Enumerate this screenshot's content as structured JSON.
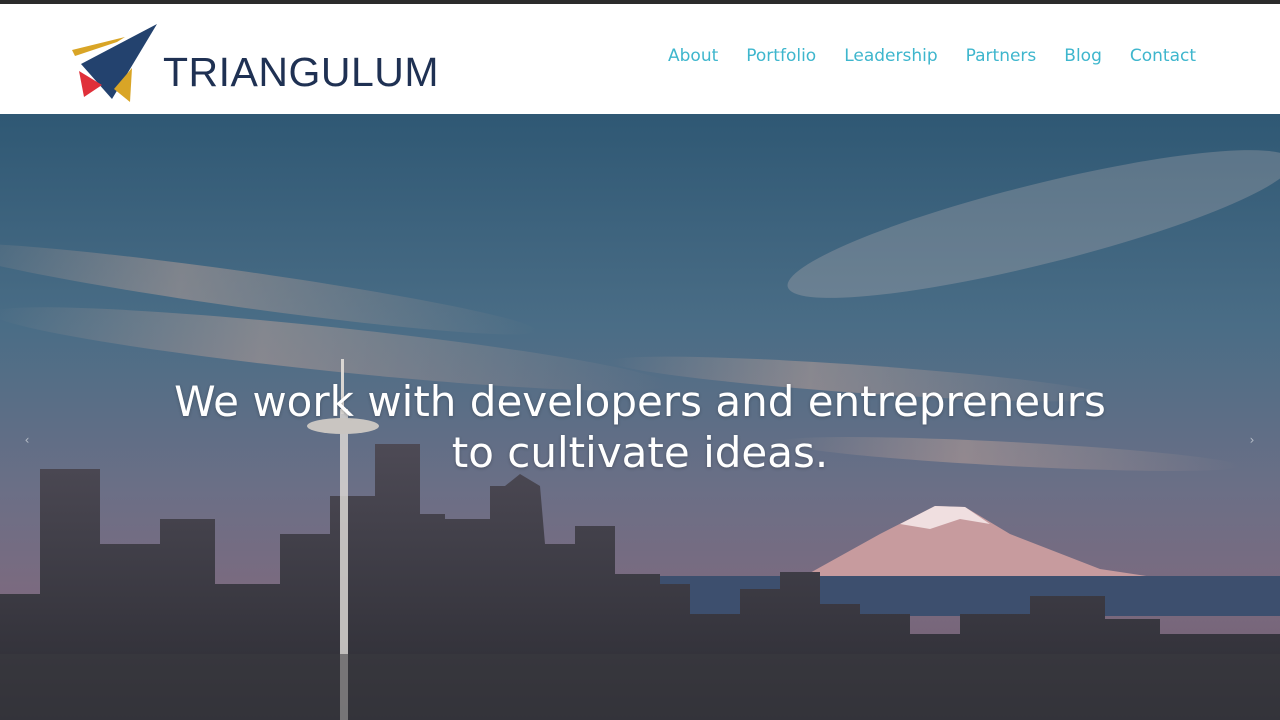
{
  "brand": {
    "name": "TRIANGULUM",
    "colors": {
      "navy": "#23426e",
      "gold": "#d9a526",
      "red": "#e0303a",
      "accent": "#3eb6cd"
    }
  },
  "nav": {
    "items": [
      {
        "label": "About"
      },
      {
        "label": "Portfolio"
      },
      {
        "label": "Leadership"
      },
      {
        "label": "Partners"
      },
      {
        "label": "Blog"
      },
      {
        "label": "Contact"
      }
    ]
  },
  "hero": {
    "headline_line1": "We work with developers and entrepreneurs",
    "headline_line2": "to cultivate ideas.",
    "prev_icon": "chevron-left-icon",
    "next_icon": "chevron-right-icon",
    "prev_glyph": "‹",
    "next_glyph": "›"
  }
}
